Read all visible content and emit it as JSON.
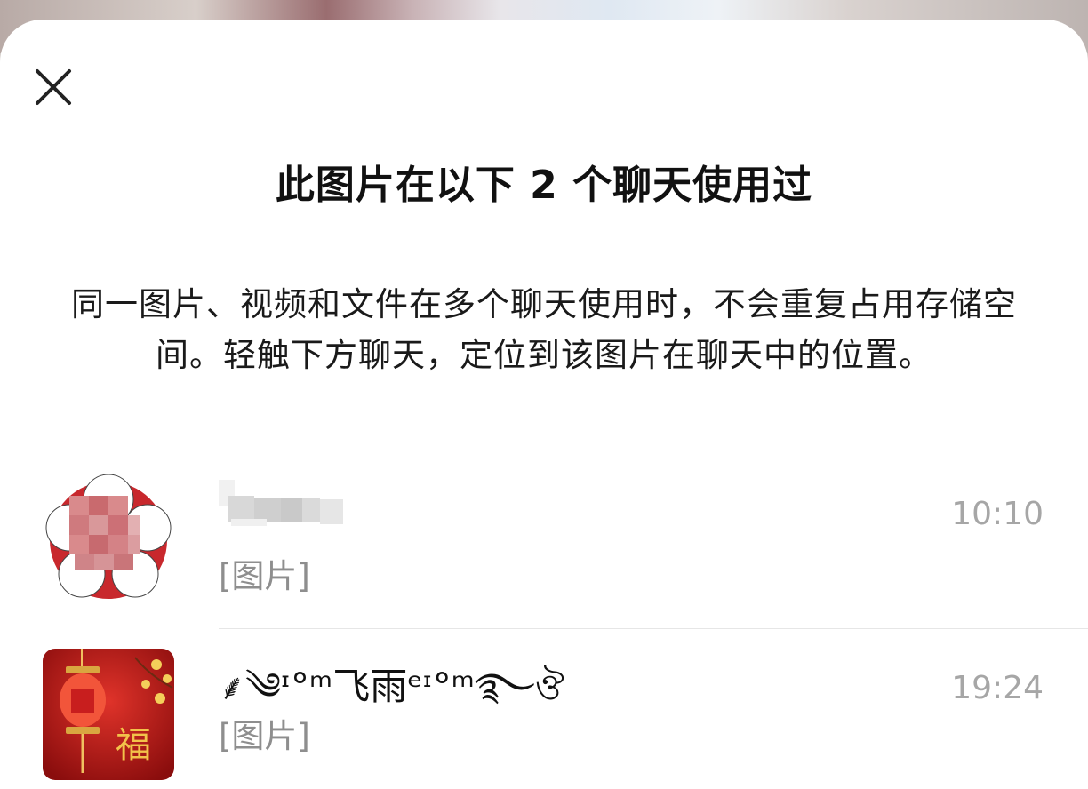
{
  "sheet": {
    "title": "此图片在以下 2 个聊天使用过",
    "description": "同一图片、视频和文件在多个聊天使用时，不会重复占用存储空间。轻触下方聊天，定位到该图片在聊天中的位置。"
  },
  "chats": [
    {
      "name": "",
      "time": "10:10",
      "preview": "[图片]",
      "avatar_icon": "pixelated-avatar"
    },
    {
      "name": "༄ᶦ°ᵐ飞雨ᵉᶦ°ᵐ࿐",
      "name_prefix": "⸙",
      "name_suffix": "ঔ",
      "time": "19:24",
      "preview": "[图片]",
      "avatar_icon": "red-lantern-fu-avatar"
    }
  ]
}
